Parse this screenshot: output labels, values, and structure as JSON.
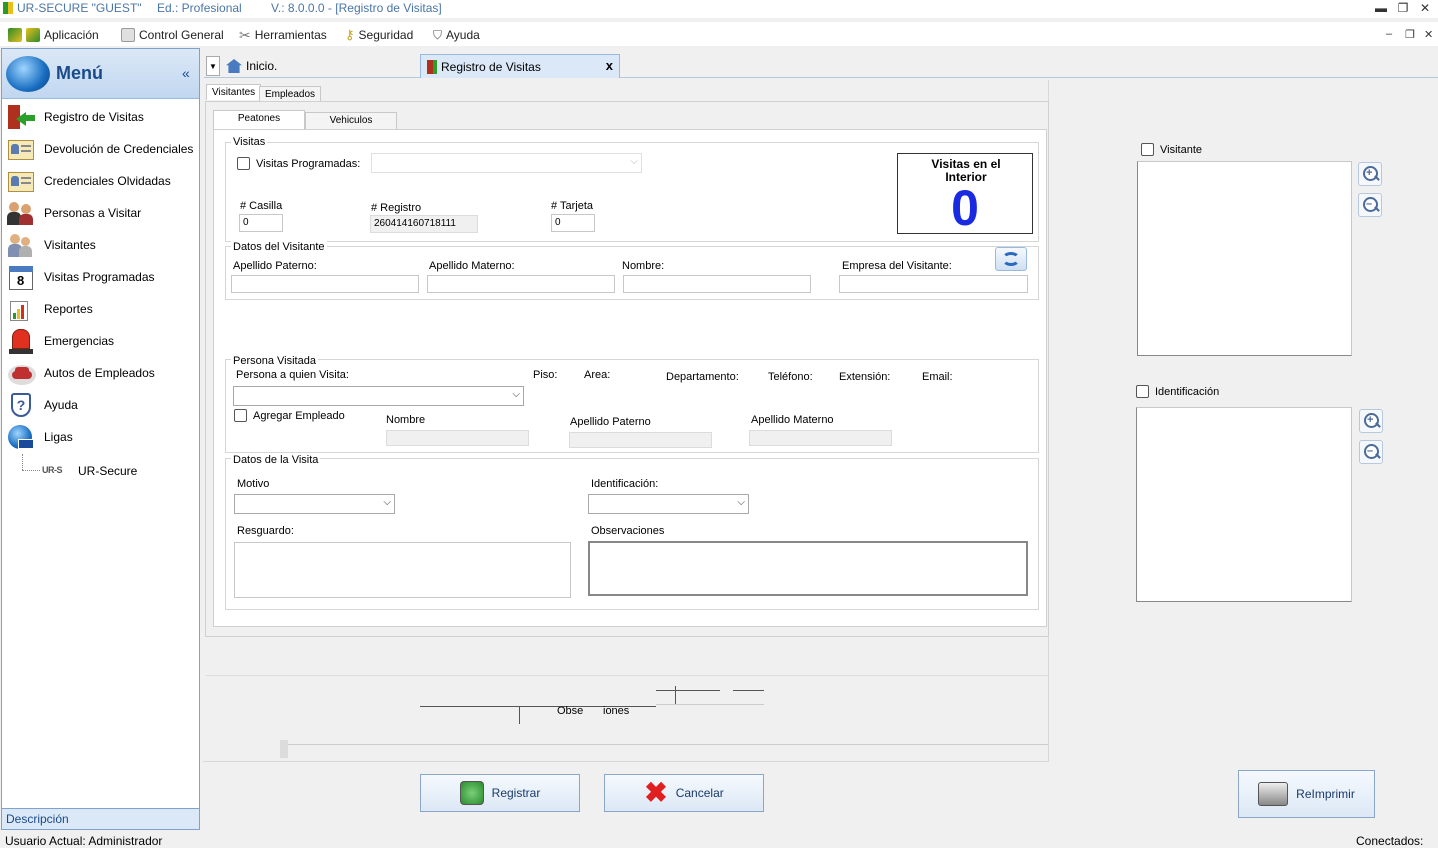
{
  "window": {
    "app": "UR-SECURE \"GUEST\"",
    "edition": "Ed.: Profesional",
    "version": "V.: 8.0.0.0 - [Registro de Visitas]",
    "minimize": "▬",
    "restore": "❐",
    "close": "✕"
  },
  "menubar": {
    "items": [
      "Aplicación",
      "Control General",
      "Herramientas",
      "Seguridad",
      "Ayuda"
    ],
    "mdi_min": "–",
    "mdi_restore": "❐",
    "mdi_close": "✕"
  },
  "sidebar": {
    "title": "Menú",
    "collapse": "«",
    "items": [
      {
        "label": "Registro de Visitas",
        "icon": "door-exit-icon"
      },
      {
        "label": "Devolución de Credenciales",
        "icon": "id-card-icon"
      },
      {
        "label": "Credenciales Olvidadas",
        "icon": "id-card-icon"
      },
      {
        "label": "Personas a Visitar",
        "icon": "people-icon"
      },
      {
        "label": "Visitantes",
        "icon": "visitors-icon"
      },
      {
        "label": "Visitas Programadas",
        "icon": "calendar-icon"
      },
      {
        "label": "Reportes",
        "icon": "report-chart-icon"
      },
      {
        "label": "Emergencias",
        "icon": "emergency-light-icon"
      },
      {
        "label": "Autos de Empleados",
        "icon": "car-icon"
      },
      {
        "label": "Ayuda",
        "icon": "help-shield-icon"
      },
      {
        "label": "Ligas",
        "icon": "globe-links-icon"
      }
    ],
    "sub_item": {
      "logo": "UR-S",
      "label": "UR-Secure"
    },
    "description": "Descripción"
  },
  "tabs": {
    "dropdown": "▼",
    "items": [
      {
        "label": "Inicio."
      },
      {
        "label": "Registro de Visitas",
        "close": "x"
      }
    ]
  },
  "form": {
    "outer_tabs": [
      "Visitantes",
      "Empleados"
    ],
    "inner_tabs": [
      "Peatones",
      "Vehiculos"
    ],
    "visitas": {
      "title": "Visitas",
      "programadas_label": "Visitas Programadas:",
      "casilla_label": "# Casilla",
      "casilla_value": "0",
      "registro_label": "# Registro",
      "registro_value": "260414160718111",
      "tarjeta_label": "# Tarjeta",
      "tarjeta_value": "0",
      "counter_title": "Visitas en el Interior",
      "counter_value": "0"
    },
    "visitante": {
      "title": "Datos del Visitante",
      "apellido_paterno": "Apellido Paterno:",
      "apellido_materno": "Apellido Materno:",
      "nombre": "Nombre:",
      "empresa": "Empresa del Visitante:"
    },
    "persona": {
      "title": "Persona Visitada",
      "quien_visita": "Persona a quien Visita:",
      "piso": "Piso:",
      "area": "Area:",
      "departamento": "Departamento:",
      "telefono": "Teléfono:",
      "extension": "Extensión:",
      "email": "Email:",
      "agregar_empleado": "Agregar Empleado",
      "nombre": "Nombre",
      "apellido_paterno": "Apellido Paterno",
      "apellido_materno": "Apellido Materno"
    },
    "visita": {
      "title": "Datos de la Visita",
      "motivo": "Motivo",
      "identificacion": "Identificación:",
      "resguardo": "Resguardo:",
      "observaciones": "Observaciones"
    },
    "ghost_text_a": "Obse",
    "ghost_text_b": "iones"
  },
  "right_panel": {
    "visitante_label": "Visitante",
    "identificacion_label": "Identificación",
    "zoom_in": "+",
    "zoom_out": "–"
  },
  "buttons": {
    "registrar": "Registrar",
    "cancelar": "Cancelar",
    "reimprimir": "ReImprimir"
  },
  "status": {
    "user": "Usuario Actual: Administrador",
    "connected": "Conectados:"
  }
}
